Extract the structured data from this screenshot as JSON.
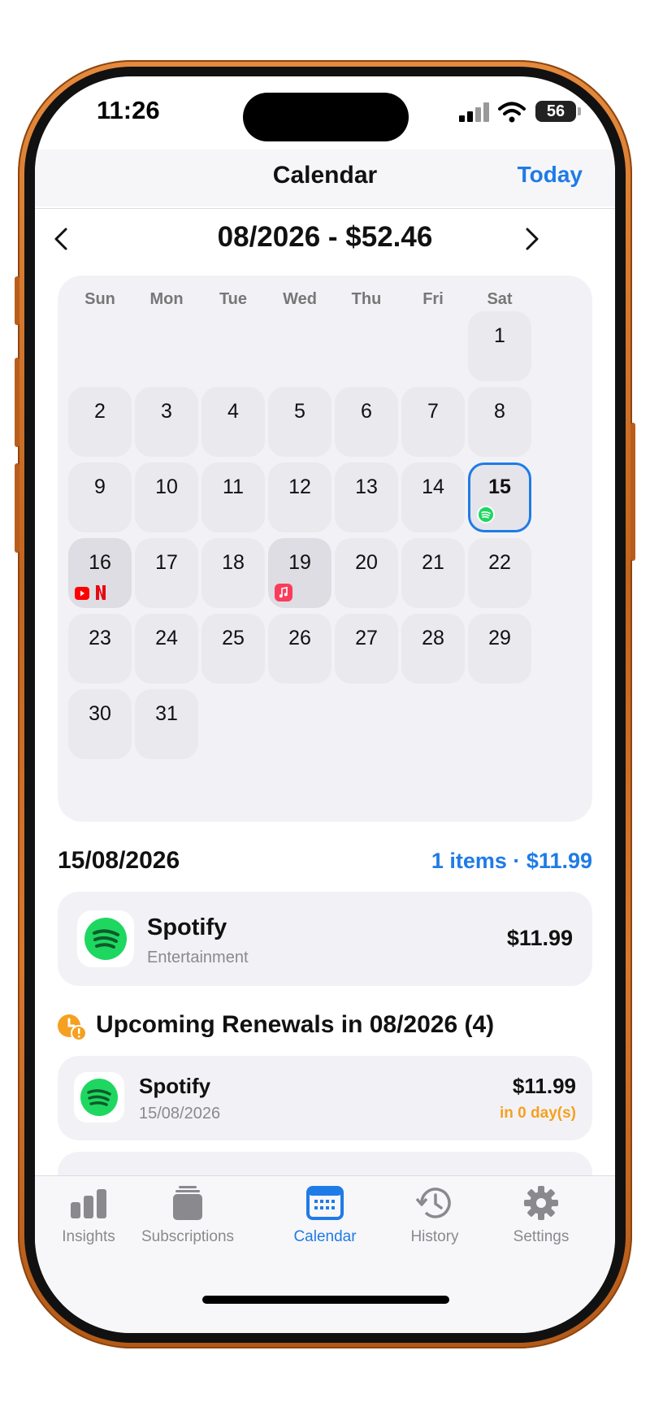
{
  "status_bar": {
    "time": "11:26",
    "battery": "56"
  },
  "nav": {
    "title": "Calendar",
    "today_label": "Today"
  },
  "month": {
    "title": "08/2026 - $52.46"
  },
  "calendar": {
    "weekdays": [
      "Sun",
      "Mon",
      "Tue",
      "Wed",
      "Thu",
      "Fri",
      "Sat"
    ],
    "days": [
      "1",
      "2",
      "3",
      "4",
      "5",
      "6",
      "7",
      "8",
      "9",
      "10",
      "11",
      "12",
      "13",
      "14",
      "15",
      "16",
      "17",
      "18",
      "19",
      "20",
      "21",
      "22",
      "23",
      "24",
      "25",
      "26",
      "27",
      "28",
      "29",
      "30",
      "31"
    ],
    "selected_day": "15"
  },
  "selected": {
    "date": "15/08/2026",
    "summary": "1 items · $11.99",
    "items": [
      {
        "name": "Spotify",
        "category": "Entertainment",
        "price": "$11.99",
        "icon": "spotify-icon"
      }
    ]
  },
  "upcoming": {
    "title": "Upcoming Renewals in 08/2026 (4)",
    "items": [
      {
        "name": "Spotify",
        "date": "15/08/2026",
        "price": "$11.99",
        "due": "in 0 day(s)",
        "icon": "spotify-icon"
      }
    ]
  },
  "tabs": [
    {
      "label": "Insights",
      "icon": "bar-chart-icon"
    },
    {
      "label": "Subscriptions",
      "icon": "stack-icon"
    },
    {
      "label": "Calendar",
      "icon": "calendar-icon"
    },
    {
      "label": "History",
      "icon": "history-icon"
    },
    {
      "label": "Settings",
      "icon": "gear-icon"
    }
  ],
  "colors": {
    "accent": "#1f7be6",
    "warning": "#f5a020",
    "spotify": "#1ed760",
    "netflix": "#e50914",
    "youtube": "#ff0000",
    "music": "#fa3c5a"
  }
}
